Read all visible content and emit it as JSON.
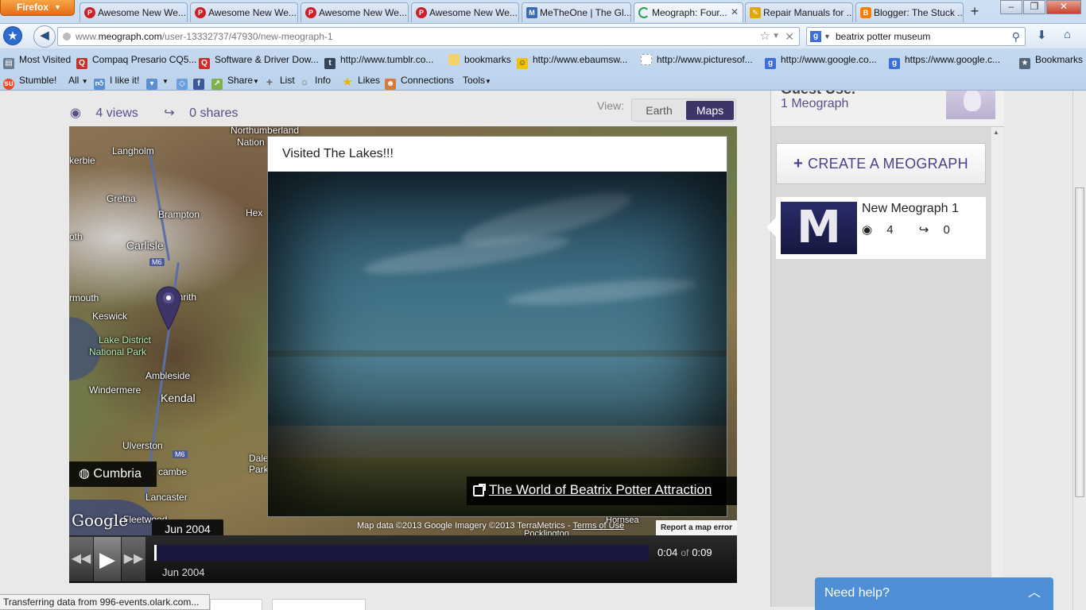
{
  "browser": {
    "menu_button": "Firefox",
    "tabs": [
      {
        "label": "Awesome New We...",
        "icon": "pinterest-icon",
        "color": "#cb2027"
      },
      {
        "label": "Awesome New We...",
        "icon": "pinterest-icon",
        "color": "#cb2027"
      },
      {
        "label": "Awesome New We...",
        "icon": "pinterest-icon",
        "color": "#cb2027"
      },
      {
        "label": "Awesome New We...",
        "icon": "pinterest-icon",
        "color": "#cb2027"
      },
      {
        "label": "MeTheOne | The Gl...",
        "icon": "metheone-icon",
        "color": "#3b6bb5"
      },
      {
        "label": "Meograph: Four...",
        "icon": "loading-icon",
        "color": "#2aa24a",
        "active": true
      },
      {
        "label": "Repair Manuals for ...",
        "icon": "pencil-icon",
        "color": "#e0a800"
      },
      {
        "label": "Blogger: The Stuck ...",
        "icon": "blogger-icon",
        "color": "#f57d00"
      }
    ],
    "url_prefix": "www.",
    "url_domain": "meograph.com",
    "url_path": "/user-13332737/47930/new-meograph-1",
    "search_value": "beatrix potter museum",
    "bookmarks": [
      {
        "label": "Most Visited",
        "icon": "most-visited-icon"
      },
      {
        "label": "Compaq Presario CQ5...",
        "icon": "bookmark-red-icon"
      },
      {
        "label": "Software & Driver Dow...",
        "icon": "bookmark-red-icon"
      },
      {
        "label": "http://www.tumblr.co...",
        "icon": "tumblr-icon"
      },
      {
        "label": "bookmarks",
        "icon": "folder-icon"
      },
      {
        "label": "http://www.ebaumsw...",
        "icon": "ebaums-icon"
      },
      {
        "label": "http://www.picturesof...",
        "icon": "page-icon"
      },
      {
        "label": "http://www.google.co...",
        "icon": "google-icon"
      },
      {
        "label": "https://www.google.c...",
        "icon": "google-icon"
      },
      {
        "label": "Bookmarks",
        "icon": "bookmarks-star-icon"
      }
    ],
    "toolbar2": {
      "stumble": "Stumble!",
      "all": "All",
      "like": "I like it!",
      "share": "Share",
      "list": "List",
      "info": "Info",
      "likes": "Likes",
      "connections": "Connections",
      "tools": "Tools"
    }
  },
  "stats": {
    "views": "4 views",
    "shares": "0 shares"
  },
  "view_toggle": {
    "label": "View:",
    "earth": "Earth",
    "maps": "Maps"
  },
  "map": {
    "labels": {
      "northumberland": "Northumberland",
      "national": "Nation",
      "langholm": "Langholm",
      "kerbie": "kerbie",
      "gretna": "Gretna",
      "brampton": "Brampton",
      "hex": "Hex",
      "oth": "oth",
      "carlisle": "Carlisle",
      "m6a": "M6",
      "rmouth": "rmouth",
      "penrith": "Penrith",
      "keswick": "Keswick",
      "lake_district": "Lake District",
      "national_park": "National Park",
      "ambleside": "Ambleside",
      "windermere": "Windermere",
      "kendal": "Kendal",
      "ulverston": "Ulverston",
      "m6b": "M6",
      "dale": "Dale",
      "park": "Park",
      "cambe": "cambe",
      "lancaster": "Lancaster",
      "fleetwood": "Fleetwood",
      "pocklington": "Pocklington",
      "hornsea": "Hornsea"
    },
    "place": "Cumbria",
    "google": "Google",
    "attribution": "Map data ©2013 Google Imagery ©2013 TerraMetrics - ",
    "terms": "Terms of Use",
    "report": "Report a map error"
  },
  "card": {
    "title": "Visited The Lakes!!!",
    "link": "The World of Beatrix Potter Attraction"
  },
  "date_chip": "Jun 2004",
  "player": {
    "current": "0:04",
    "of": "of",
    "total": "0:09",
    "date": "Jun 2004",
    "progress": 0.0
  },
  "sidebar": {
    "user_name": "Guest Use.",
    "count": "1 Meograph",
    "create": "CREATE A MEOGRAPH",
    "item": {
      "thumb_letter": "M",
      "title": "New Meograph 1",
      "views": "4",
      "shares": "0"
    }
  },
  "status": "Transferring data from 996-events.olark.com...",
  "help": "Need help?"
}
